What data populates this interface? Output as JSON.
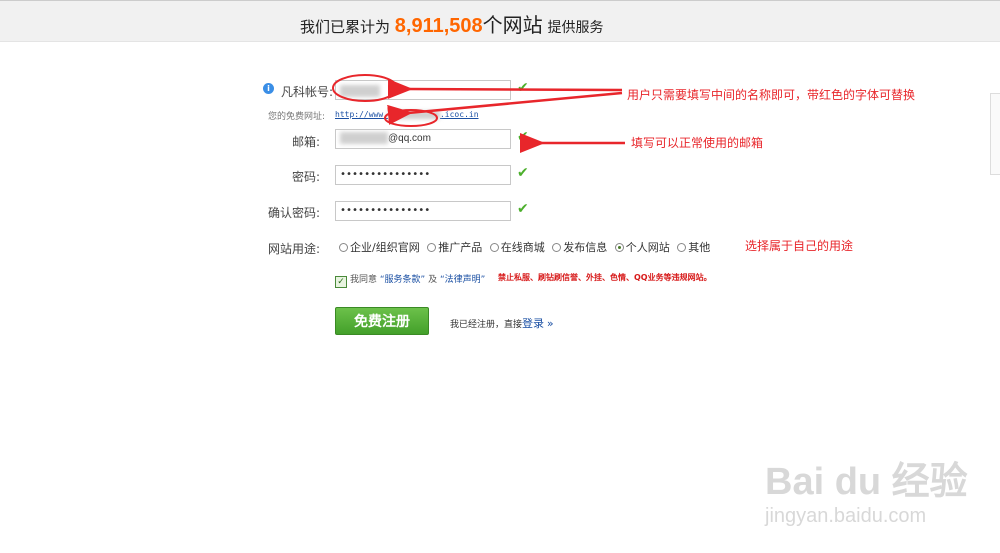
{
  "header": {
    "prefix": "我们已累计为",
    "count": "8,911,508",
    "unit": "个网站",
    "suffix": "提供服务"
  },
  "form": {
    "account_label": "凡科帐号:",
    "free_url_label": "您的免费网址:",
    "free_url_prefix": "http://www.",
    "free_url_suffix": ".icoc.in",
    "email_label": "邮箱:",
    "email_suffix": "@qq.com",
    "password_label": "密码:",
    "password_value": "•••••••••••••••",
    "confirm_label": "确认密码:",
    "confirm_value": "•••••••••••••••",
    "purpose_label": "网站用途:",
    "purpose_options": [
      "企业/组织官网",
      "推广产品",
      "在线商城",
      "发布信息",
      "个人网站",
      "其他"
    ],
    "purpose_selected": "个人网站",
    "agree_prefix": "我同意",
    "terms_link": "“服务条款”",
    "and": "及",
    "legal_link": "“法律声明”",
    "warning": "禁止私服、刷钻刷信誉、外挂、色情、QQ业务等违规网站。",
    "register_button": "免费注册",
    "already_text": "我已经注册，直接",
    "login_link": "登录",
    "login_arrow": "»"
  },
  "annotations": {
    "account_note": "用户只需要填写中间的名称即可，带红色的字体可替换",
    "email_note": "填写可以正常使用的邮箱",
    "purpose_note": "选择属于自己的用途",
    "color": "#e8262b"
  },
  "watermark": {
    "logo": "Bai du 经验",
    "url": "jingyan.baidu.com"
  }
}
